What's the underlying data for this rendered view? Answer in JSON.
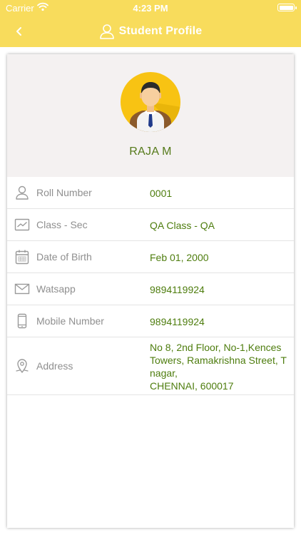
{
  "status_bar": {
    "carrier": "Carrier",
    "time": "4:23 PM"
  },
  "nav": {
    "title": "Student Profile",
    "back_icon": "chevron-left-icon",
    "title_icon": "person-outline-icon"
  },
  "profile": {
    "name": "RAJA M",
    "avatar_icon": "student-avatar-icon"
  },
  "fields": [
    {
      "icon": "person-icon",
      "label": "Roll Number",
      "value": "0001"
    },
    {
      "icon": "chart-icon",
      "label": "Class - Sec",
      "value": "QA Class -  QA"
    },
    {
      "icon": "calendar-icon",
      "label": "Date of Birth",
      "value": "Feb 01, 2000"
    },
    {
      "icon": "mail-icon",
      "label": "Watsapp",
      "value": "9894119924"
    },
    {
      "icon": "phone-icon",
      "label": "Mobile Number",
      "value": "9894119924"
    },
    {
      "icon": "location-icon",
      "label": "Address",
      "value_lines": [
        "No 8, 2nd Floor, No-1,Kences",
        "Towers, Ramakrishna Street, T",
        "nagar,",
        "CHENNAI, 600017"
      ]
    }
  ],
  "colors": {
    "header_bg": "#f8dc5c",
    "accent_text": "#557a1a",
    "label_text": "#8f8f8f",
    "card_header_bg": "#f4f1f1"
  }
}
